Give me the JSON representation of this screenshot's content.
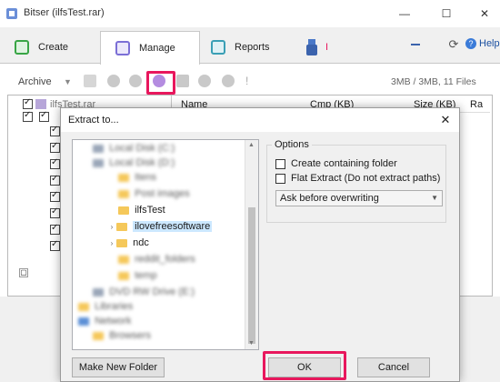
{
  "window": {
    "title": "Bitser (ilfsTest.rar)",
    "minimize": "—",
    "maximize": "☐",
    "close": "✕"
  },
  "tabs": [
    {
      "label": "Create",
      "color": "#38a545"
    },
    {
      "label": "Manage",
      "color": "#7b6fd6"
    },
    {
      "label": "Reports",
      "color": "#3a9fb5"
    },
    {
      "label": "I",
      "color": "#e8175d"
    }
  ],
  "topright": {
    "help": "Help"
  },
  "toolbar": {
    "archive_label": "Archive",
    "stats": "3MB / 3MB, 11 Files"
  },
  "archive_tree": {
    "root": "ilfsTest.rar"
  },
  "file_list": {
    "columns": [
      "Name",
      "Cmp (KB)",
      "Size (KB)",
      "Ra"
    ]
  },
  "dialog": {
    "title": "Extract to...",
    "close": "✕",
    "tree": {
      "visible_items": [
        "ilfsTest",
        "ilovefreesoftware",
        "ndc"
      ]
    },
    "options": {
      "group_label": "Options",
      "create_folder": "Create containing folder",
      "flat_extract": "Flat Extract (Do not extract paths)",
      "overwrite_value": "Ask before overwriting"
    },
    "buttons": {
      "new_folder": "Make New Folder",
      "ok": "OK",
      "cancel": "Cancel"
    }
  },
  "colors": {
    "highlight": "#e8175d",
    "selection": "#cce8ff"
  }
}
